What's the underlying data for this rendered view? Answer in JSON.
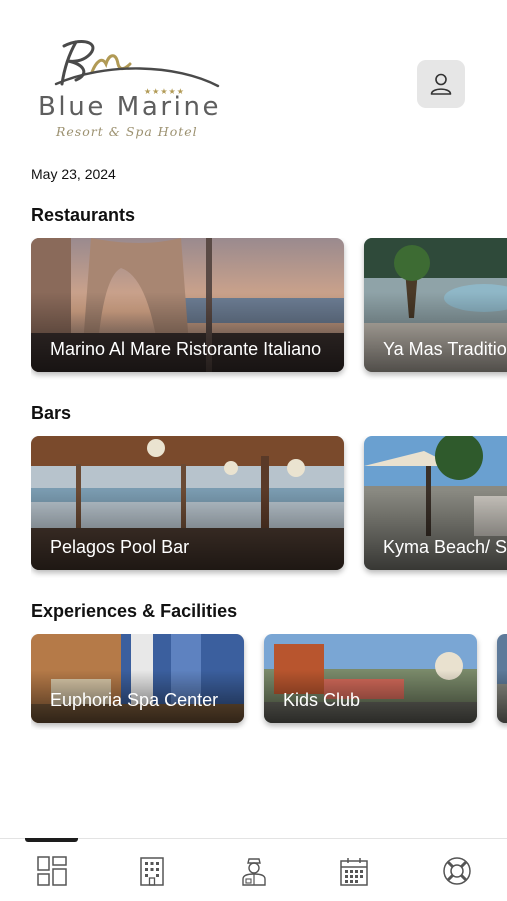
{
  "header": {
    "logo_monogram": "BM",
    "logo_stars": "★★★★★",
    "logo_name": "Blue Marine",
    "logo_tagline": "Resort & Spa Hotel",
    "profile_icon": "user-icon"
  },
  "date": "May 23, 2024",
  "sections": {
    "restaurants": {
      "title": "Restaurants",
      "items": [
        {
          "label": "Marino Al Mare Ristorante Italiano"
        },
        {
          "label": "Ya Mas Traditional Tavern"
        }
      ]
    },
    "bars": {
      "title": "Bars",
      "items": [
        {
          "label": "Pelagos Pool Bar"
        },
        {
          "label": "Kyma Beach/ Snack Bar"
        }
      ]
    },
    "experiences": {
      "title": "Experiences & Facilities",
      "items": [
        {
          "label": "Euphoria Spa Center"
        },
        {
          "label": "Kids Club"
        },
        {
          "label": ""
        }
      ]
    }
  },
  "tabbar": {
    "active_index": 0,
    "tabs": [
      {
        "icon": "dashboard-icon"
      },
      {
        "icon": "hotel-building-icon"
      },
      {
        "icon": "concierge-icon"
      },
      {
        "icon": "calendar-icon"
      },
      {
        "icon": "lifebuoy-icon"
      }
    ]
  },
  "colors": {
    "accent": "#1d1d1d",
    "logo_gold": "#b19a55",
    "logo_gray": "#5e5e5e"
  }
}
